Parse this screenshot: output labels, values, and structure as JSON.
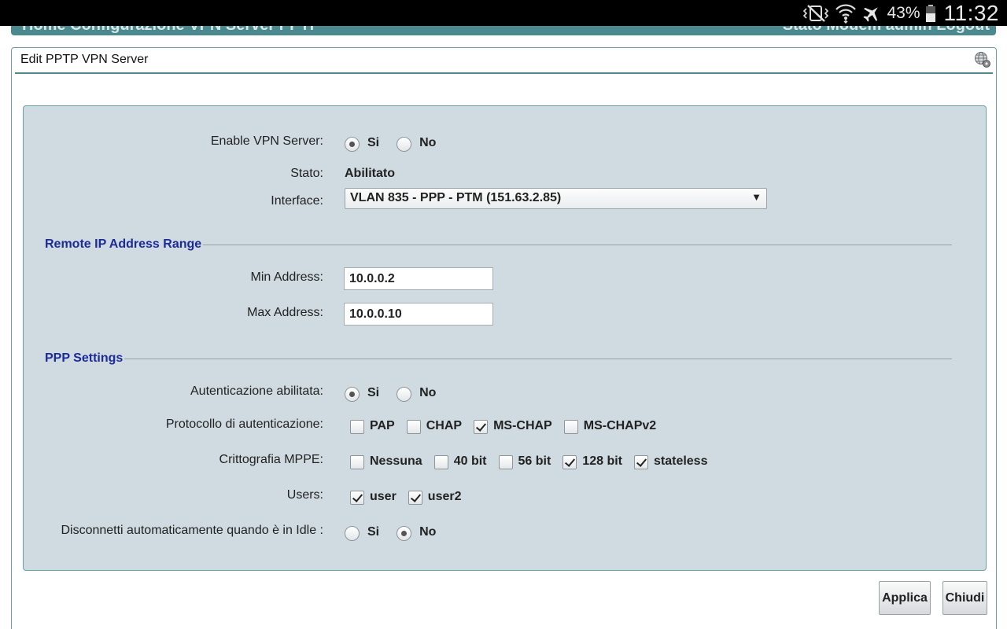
{
  "statusbar": {
    "battery_pct": "43%",
    "clock": "11:32",
    "icons": [
      "mute-vibrate-icon",
      "wifi-icon",
      "airplane-mode-icon",
      "battery-icon"
    ]
  },
  "navbar": {
    "left_text": "Home  Configurazione  VPN  Server  PPTP",
    "right_text": "Stato  Modem  admin  Logout"
  },
  "dialog": {
    "title": "Edit PPTP VPN Server",
    "icon": "globe-settings-icon"
  },
  "form": {
    "enable_vpn": {
      "label": "Enable VPN Server:",
      "options": [
        "Si",
        "No"
      ],
      "selected": "Si"
    },
    "stato": {
      "label": "Stato:",
      "value": "Abilitato"
    },
    "interface": {
      "label": "Interface:",
      "value": "VLAN 835 - PPP - PTM (151.63.2.85)"
    },
    "remote_range": {
      "title": "Remote IP Address Range",
      "min_label": "Min Address:",
      "min_value": "10.0.0.2",
      "max_label": "Max Address:",
      "max_value": "10.0.0.10"
    },
    "ppp": {
      "title": "PPP Settings",
      "auth_enabled": {
        "label": "Autenticazione abilitata:",
        "options": [
          "Si",
          "No"
        ],
        "selected": "Si"
      },
      "auth_protocol": {
        "label": "Protocollo di autenticazione:",
        "items": [
          {
            "label": "PAP",
            "checked": false
          },
          {
            "label": "CHAP",
            "checked": false
          },
          {
            "label": "MS-CHAP",
            "checked": true
          },
          {
            "label": "MS-CHAPv2",
            "checked": false
          }
        ]
      },
      "mppe": {
        "label": "Crittografia MPPE:",
        "items": [
          {
            "label": "Nessuna",
            "checked": false
          },
          {
            "label": "40 bit",
            "checked": false
          },
          {
            "label": "56 bit",
            "checked": false
          },
          {
            "label": "128 bit",
            "checked": true
          },
          {
            "label": "stateless",
            "checked": true
          }
        ]
      },
      "users": {
        "label": "Users:",
        "items": [
          {
            "label": "user",
            "checked": true
          },
          {
            "label": "user2",
            "checked": true
          }
        ]
      },
      "idle_disconnect": {
        "label": "Disconnetti automaticamente quando è in Idle :",
        "options": [
          "Si",
          "No"
        ],
        "selected": "No"
      }
    }
  },
  "buttons": {
    "apply": "Applica",
    "close": "Chiudi"
  }
}
